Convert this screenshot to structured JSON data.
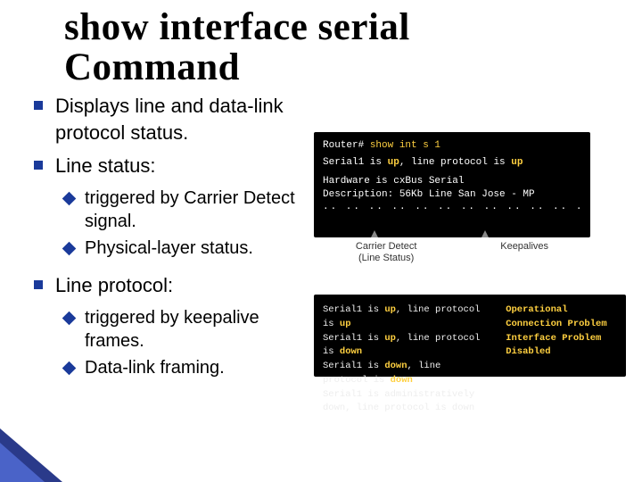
{
  "title_line1": "show interface serial",
  "title_line2": "Command",
  "bullets": {
    "b1": "Displays line and data-link protocol status.",
    "b2": "Line status:",
    "b2a": "triggered by Carrier Detect signal.",
    "b2b": "Physical-layer status.",
    "b3": "Line protocol:",
    "b3a": "triggered by keepalive frames.",
    "b3b": "Data-link framing."
  },
  "panel1": {
    "prompt_host": "Router#",
    "prompt_cmd": " show int s 1",
    "line1a": "Serial1 is ",
    "line1b": "up",
    "line1c": ", line protocol is ",
    "line1d": "up",
    "line2": "Hardware is cxBus Serial",
    "line3": "Description: 56Kb Line San Jose - MP",
    "dots": ".. .. .. .. .. .. .. .. .. .. .. .. .. .. .."
  },
  "callouts": {
    "c1a": "Carrier Detect",
    "c1b": "(Line Status)",
    "c2": "Keepalives"
  },
  "panel2": {
    "left": {
      "r1a": "Serial1 is ",
      "r1b": "up",
      "r1c": ", line protocol is ",
      "r1d": "up",
      "r2a": "Serial1 is ",
      "r2b": "up",
      "r2c": ", line protocol is ",
      "r2d": "down",
      "r3a": "Serial1 is ",
      "r3b": "down",
      "r3c": ", line protocol is ",
      "r3d": "down",
      "r4a": "Serial1 is administratively down, line protocol is down"
    },
    "right": {
      "r1": "Operational",
      "r2": "Connection Problem",
      "r3": "Interface Problem",
      "r4": "Disabled"
    }
  }
}
